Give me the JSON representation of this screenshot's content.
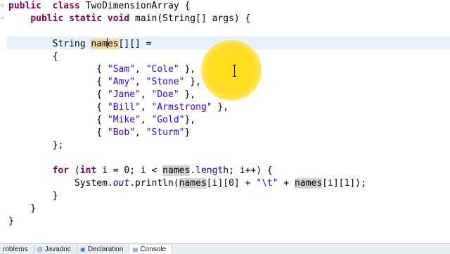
{
  "code_lines": [
    {
      "parts": [
        [
          "kw",
          "public"
        ],
        [
          "",
          "  "
        ],
        [
          "kw",
          "class"
        ],
        [
          "",
          " TwoDimensionArray {"
        ]
      ]
    },
    {
      "parts": [
        [
          "",
          "    "
        ],
        [
          "kw",
          "public"
        ],
        [
          "",
          " "
        ],
        [
          "kw",
          "static"
        ],
        [
          "",
          " "
        ],
        [
          "kw",
          "void"
        ],
        [
          "",
          " main(String[] args) {"
        ]
      ]
    },
    {
      "parts": [
        [
          "",
          ""
        ]
      ]
    },
    {
      "parts": [
        [
          "",
          "        String "
        ],
        [
          "occ-sel",
          "nam"
        ],
        [
          "caret",
          ""
        ],
        [
          "occ-sel",
          "es"
        ],
        [
          "",
          "[][] ="
        ]
      ]
    },
    {
      "parts": [
        [
          "",
          "        {"
        ]
      ]
    },
    {
      "parts": [
        [
          "",
          "                { "
        ],
        [
          "str",
          "\"Sam\""
        ],
        [
          "",
          ", "
        ],
        [
          "str",
          "\"Cole\""
        ],
        [
          "",
          " },"
        ]
      ]
    },
    {
      "parts": [
        [
          "",
          "                { "
        ],
        [
          "str",
          "\"Amy\""
        ],
        [
          "",
          ", "
        ],
        [
          "str",
          "\"Stone\""
        ],
        [
          "",
          " },"
        ]
      ]
    },
    {
      "parts": [
        [
          "",
          "                { "
        ],
        [
          "str",
          "\"Jane\""
        ],
        [
          "",
          ", "
        ],
        [
          "str",
          "\"Doe\""
        ],
        [
          "",
          " },"
        ]
      ]
    },
    {
      "parts": [
        [
          "",
          "                { "
        ],
        [
          "str",
          "\"Bill\""
        ],
        [
          "",
          ", "
        ],
        [
          "str",
          "\"Armstrong\""
        ],
        [
          "",
          " },"
        ]
      ]
    },
    {
      "parts": [
        [
          "",
          "                { "
        ],
        [
          "str",
          "\"Mike\""
        ],
        [
          "",
          ", "
        ],
        [
          "str",
          "\"Gold\""
        ],
        [
          "",
          "},"
        ]
      ]
    },
    {
      "parts": [
        [
          "",
          "                { "
        ],
        [
          "str",
          "\"Bob\""
        ],
        [
          "",
          ", "
        ],
        [
          "str",
          "\"Sturm\""
        ],
        [
          "",
          "}"
        ]
      ]
    },
    {
      "parts": [
        [
          "",
          "        };"
        ]
      ]
    },
    {
      "parts": [
        [
          "",
          ""
        ]
      ]
    },
    {
      "parts": [
        [
          "",
          "        "
        ],
        [
          "kw",
          "for"
        ],
        [
          "",
          " ("
        ],
        [
          "kw",
          "int"
        ],
        [
          "",
          " i = 0; i < "
        ],
        [
          "occ",
          "names"
        ],
        [
          "",
          "."
        ],
        [
          "fld",
          "length"
        ],
        [
          "",
          "; i++) {"
        ]
      ]
    },
    {
      "parts": [
        [
          "",
          "            System."
        ],
        [
          "fld static",
          "out"
        ],
        [
          "",
          ".println("
        ],
        [
          "occ",
          "names"
        ],
        [
          "",
          "[i][0] + "
        ],
        [
          "str",
          "\"\\t\""
        ],
        [
          "",
          " + "
        ],
        [
          "occ",
          "names"
        ],
        [
          "",
          "[i][1]);"
        ]
      ]
    },
    {
      "parts": [
        [
          "",
          "        }"
        ]
      ]
    },
    {
      "parts": [
        [
          "",
          "    }"
        ]
      ]
    },
    {
      "parts": [
        [
          "",
          "}"
        ]
      ]
    },
    {
      "parts": [
        [
          "",
          ""
        ]
      ]
    }
  ],
  "bottom_tabs": [
    {
      "label": "roblems",
      "icon": "problems-icon",
      "active": false
    },
    {
      "label": "Javadoc",
      "icon": "javadoc-icon",
      "active": false
    },
    {
      "label": "Declaration",
      "icon": "declaration-icon",
      "active": false
    },
    {
      "label": "Console",
      "icon": "console-icon",
      "active": true
    }
  ]
}
